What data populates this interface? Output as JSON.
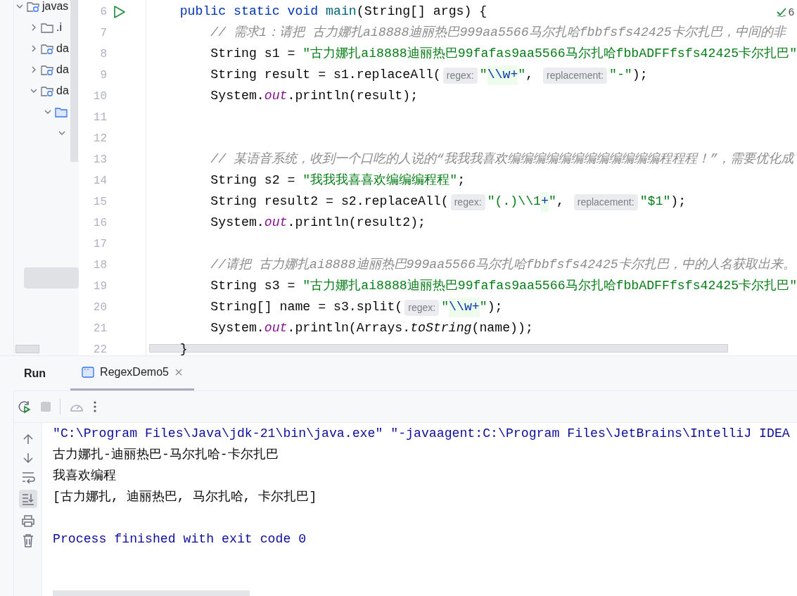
{
  "project_tree": [
    {
      "label": "javas",
      "expanded": true,
      "kind": "module",
      "children": [
        {
          "label": ".i",
          "expanded": false,
          "kind": "folder"
        },
        {
          "label": "da",
          "expanded": false,
          "kind": "module"
        },
        {
          "label": "da",
          "expanded": false,
          "kind": "module"
        },
        {
          "label": "da",
          "expanded": true,
          "kind": "module",
          "children": [
            {
              "expanded": true,
              "kind": "source",
              "children": [
                {
                  "expanded": true
                }
              ]
            }
          ]
        }
      ]
    }
  ],
  "editor": {
    "inspection_count": "6",
    "method": {
      "header": {
        "number": "6",
        "runnable": true,
        "tokens": [
          {
            "kind": "keyword",
            "text": "public static void "
          },
          {
            "kind": "method_decl",
            "text": "main"
          },
          {
            "kind": "plain",
            "text": "(String[] args) {"
          }
        ]
      },
      "body": [
        {
          "number": "7",
          "tokens": [
            {
              "kind": "comment",
              "text": "// 需求1：请把 古力娜扎ai8888迪丽热巴999aa5566马尔扎哈fbbfsfs42425卡尔扎巴，中间的非"
            }
          ]
        },
        {
          "number": "8",
          "tokens": [
            {
              "kind": "plain",
              "text": "String s1 = "
            },
            {
              "kind": "string",
              "text": "\"古力娜扎ai8888迪丽热巴99fafas9aa5566马尔扎哈fbbADFFfsfs42425卡尔扎巴\""
            }
          ]
        },
        {
          "number": "9",
          "tokens": [
            {
              "kind": "plain",
              "text": "String result = s1.replaceAll("
            },
            {
              "kind": "hint",
              "text": "regex:"
            },
            {
              "kind": "string",
              "text": "\""
            },
            {
              "kind": "escape",
              "text": "\\\\w+"
            },
            {
              "kind": "string",
              "text": "\""
            },
            {
              "kind": "plain",
              "text": ", "
            },
            {
              "kind": "hint",
              "text": "replacement:"
            },
            {
              "kind": "string",
              "text": "\"-\""
            },
            {
              "kind": "plain",
              "text": ");"
            }
          ]
        },
        {
          "number": "10",
          "tokens": [
            {
              "kind": "plain",
              "text": "System."
            },
            {
              "kind": "field",
              "text": "out"
            },
            {
              "kind": "plain",
              "text": ".println(result);"
            }
          ]
        },
        {
          "number": "11"
        },
        {
          "number": "12"
        },
        {
          "number": "13",
          "tokens": [
            {
              "kind": "comment",
              "text": "// 某语音系统，收到一个口吃的人说的“我我我喜欢编编编编编编编编编编编编程程程！”，需要优化成"
            }
          ]
        },
        {
          "number": "14",
          "tokens": [
            {
              "kind": "plain",
              "text": "String s2 = "
            },
            {
              "kind": "string",
              "text": "\"我我我喜喜欢编编编程程\""
            },
            {
              "kind": "plain",
              "text": ";"
            }
          ]
        },
        {
          "number": "15",
          "tokens": [
            {
              "kind": "plain",
              "text": "String result2 = s2.replaceAll("
            },
            {
              "kind": "hint",
              "text": "regex:"
            },
            {
              "kind": "string",
              "text": "\"(.)\\\\1"
            },
            {
              "kind": "escape",
              "text": "+"
            },
            {
              "kind": "string",
              "text": "\""
            },
            {
              "kind": "plain",
              "text": ", "
            },
            {
              "kind": "hint",
              "text": "replacement:"
            },
            {
              "kind": "string",
              "text": "\"$1\""
            },
            {
              "kind": "plain",
              "text": ");"
            }
          ]
        },
        {
          "number": "16",
          "tokens": [
            {
              "kind": "plain",
              "text": "System."
            },
            {
              "kind": "field",
              "text": "out"
            },
            {
              "kind": "plain",
              "text": ".println(result2);"
            }
          ]
        },
        {
          "number": "17"
        },
        {
          "number": "18",
          "tokens": [
            {
              "kind": "comment",
              "text": "//请把 古力娜扎ai8888迪丽热巴999aa5566马尔扎哈fbbfsfs42425卡尔扎巴，中的人名获取出来。"
            }
          ]
        },
        {
          "number": "19",
          "tokens": [
            {
              "kind": "plain",
              "text": "String s3 = "
            },
            {
              "kind": "string",
              "text": "\"古力娜扎ai8888迪丽热巴99fafas9aa5566马尔扎哈fbbADFFfsfs42425卡尔扎巴\""
            }
          ]
        },
        {
          "number": "20",
          "tokens": [
            {
              "kind": "plain",
              "text": "String[] name = s3.split("
            },
            {
              "kind": "hint",
              "text": "regex:"
            },
            {
              "kind": "string",
              "text": "\""
            },
            {
              "kind": "escape",
              "text": "\\\\w+"
            },
            {
              "kind": "string",
              "text": "\""
            },
            {
              "kind": "plain",
              "text": ");"
            }
          ]
        },
        {
          "number": "21",
          "tokens": [
            {
              "kind": "plain",
              "text": "System."
            },
            {
              "kind": "field",
              "text": "out"
            },
            {
              "kind": "plain",
              "text": ".println(Arrays."
            },
            {
              "kind": "static_method",
              "text": "toString"
            },
            {
              "kind": "plain",
              "text": "(name));"
            }
          ]
        }
      ],
      "footer": {
        "number": "22",
        "tokens": [
          {
            "kind": "plain",
            "text": "}"
          }
        ]
      }
    }
  },
  "run_panel": {
    "title": "Run",
    "tabs": [
      {
        "label": "RegexDemo5",
        "selected": true,
        "closable": true
      }
    ],
    "console": [
      {
        "kind": "system",
        "text": "\"C:\\Program Files\\Java\\jdk-21\\bin\\java.exe\" \"-javaagent:C:\\Program Files\\JetBrains\\IntelliJ IDEA"
      },
      {
        "kind": "output",
        "text": "古力娜扎-迪丽热巴-马尔扎哈-卡尔扎巴"
      },
      {
        "kind": "output",
        "text": "我喜欢编程"
      },
      {
        "kind": "output",
        "text": "[古力娜扎, 迪丽热巴, 马尔扎哈, 卡尔扎巴]"
      },
      {
        "kind": "blank"
      },
      {
        "kind": "system",
        "text": "Process finished with exit code 0"
      }
    ]
  }
}
